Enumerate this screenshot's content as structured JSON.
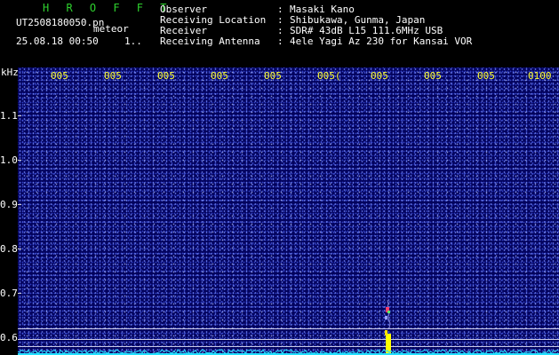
{
  "header": {
    "app_name": "H R O F F T",
    "filename": "UT2508180050.pn",
    "meteor_label": "meteor",
    "timestamp": "25.08.18 00:50",
    "index": "1..",
    "fields": [
      {
        "label": "Observer",
        "value": "Masaki Kano"
      },
      {
        "label": "Receiving Location",
        "value": "Shibukawa, Gunma, Japan"
      },
      {
        "label": "Receiver",
        "value": "SDR# 43dB L15 111.6MHz USB"
      },
      {
        "label": "Receiving Antenna",
        "value": "4ele Yagi Az 230 for Kansai VOR"
      }
    ],
    "colon": ":"
  },
  "yaxis": {
    "unit": "kHz",
    "ticks": [
      "1.1",
      "1.0",
      "0.9",
      "0.8",
      "0.7",
      "0.6"
    ]
  },
  "xaxis": {
    "ticks": [
      "005",
      "005",
      "005",
      "005",
      "005",
      "005(",
      "005",
      "005",
      "005",
      "0100"
    ]
  },
  "colors": {
    "background": "#03035e",
    "tick_text": "#ffff33",
    "app_name": "#2ed12e",
    "noise_floor": "#22e0ff",
    "meteor_core": "#ffff00"
  }
}
